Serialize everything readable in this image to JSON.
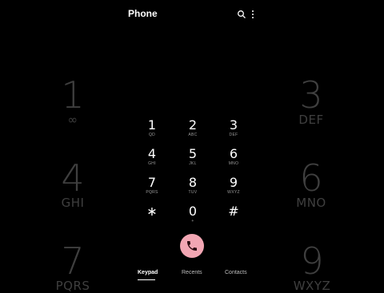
{
  "app": {
    "title": "Phone"
  },
  "background_keys": [
    {
      "digit": "1",
      "letters": "∞"
    },
    {
      "digit": "3",
      "letters": "DEF"
    },
    {
      "digit": "4",
      "letters": "GHI"
    },
    {
      "digit": "6",
      "letters": "MNO"
    },
    {
      "digit": "7",
      "letters": "PQRS"
    },
    {
      "digit": "9",
      "letters": "WXYZ"
    }
  ],
  "keypad": [
    {
      "digit": "1",
      "letters": "QD"
    },
    {
      "digit": "2",
      "letters": "ABC"
    },
    {
      "digit": "3",
      "letters": "DEF"
    },
    {
      "digit": "4",
      "letters": "GHI"
    },
    {
      "digit": "5",
      "letters": "JKL"
    },
    {
      "digit": "6",
      "letters": "MNO"
    },
    {
      "digit": "7",
      "letters": "PQRS"
    },
    {
      "digit": "8",
      "letters": "TUV"
    },
    {
      "digit": "9",
      "letters": "WXYZ"
    },
    {
      "digit": "∗",
      "letters": ""
    },
    {
      "digit": "0",
      "letters": "+"
    },
    {
      "digit": "#",
      "letters": ""
    }
  ],
  "call": {
    "color": "#f2a6b3",
    "icon": "phone-icon"
  },
  "tabs": [
    {
      "label": "Keypad",
      "active": true
    },
    {
      "label": "Recents",
      "active": false
    },
    {
      "label": "Contacts",
      "active": false
    }
  ],
  "icons": {
    "search": "search-icon",
    "more": "more-vert-icon"
  }
}
